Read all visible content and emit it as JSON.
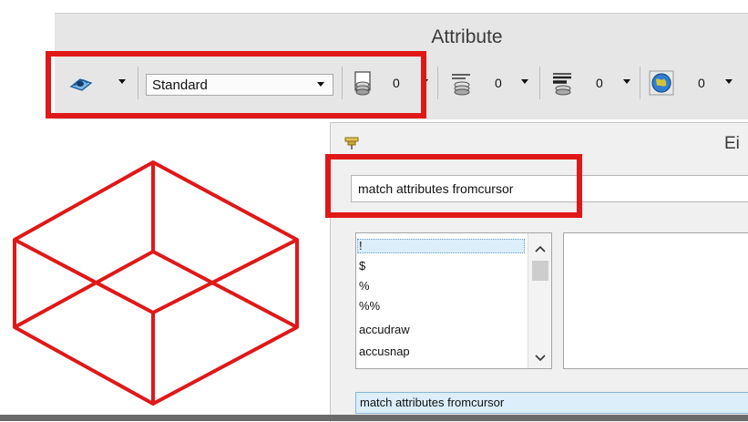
{
  "attribute_panel": {
    "title": "Attribute",
    "toolbar": {
      "element_template_icon": "element-template-icon",
      "style_combo": {
        "value": "Standard"
      },
      "level_picker": {
        "icon": "level-stack-icon",
        "value": "0"
      },
      "color_picker": {
        "icon": "color-layers-icon",
        "value": "0"
      },
      "weight_picker": {
        "icon": "line-weight-icon",
        "value": "0"
      },
      "globe_picker": {
        "icon": "globe-icon",
        "value": "0"
      }
    }
  },
  "key_in_window": {
    "title_partial": "Ei",
    "key_in_field": {
      "value": "match attributes fromcursor"
    },
    "command_list": {
      "items": [
        "!",
        "$",
        "%",
        "%%",
        "accudraw",
        "accusnap"
      ]
    },
    "history_entry": "match attributes fromcursor"
  },
  "drawing": {
    "shape": "box-wireframe",
    "stroke_color": "#e01818"
  },
  "highlight_color": "#e01818"
}
